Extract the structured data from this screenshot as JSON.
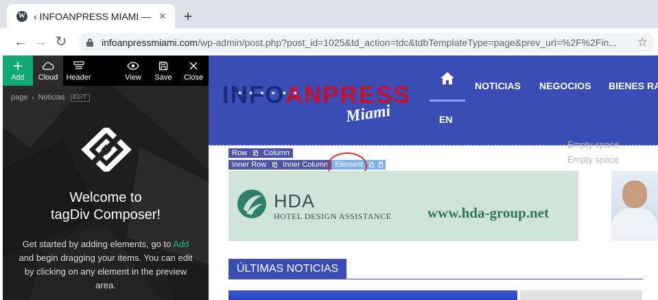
{
  "browser": {
    "tab_title": "‹ INFOANPRESS MIAMI —",
    "favicon": "W",
    "url_host": "infoanpressmiami.com",
    "url_path": "/wp-admin/post.php?post_id=1025&td_action=tdc&tdbTemplateType=page&prev_url=%2F%2Fin..."
  },
  "panel": {
    "toolbar": {
      "add": "Add",
      "cloud": "Cloud",
      "header": "Header",
      "view": "View",
      "save": "Save",
      "close": "Close"
    },
    "breadcrumb": {
      "page": "page",
      "current": "Noticias",
      "edit": "EDIT"
    },
    "welcome_line1": "Welcome to",
    "welcome_line2": "tagDiv Composer!",
    "intro_before": "Get started by adding elements, go to",
    "intro_add": "Add",
    "intro_after": "and begin dragging your items. You can edit by clicking on any element in the preview area."
  },
  "site": {
    "brand_info": "INFO",
    "brand_anpress": "ANPRESS",
    "brand_miami": "Miami",
    "nav": [
      "NOTICIAS",
      "NEGOCIOS",
      "BIENES RA"
    ],
    "lang": "EN",
    "empty_space_1": "Empty space",
    "empty_space_2": "Empty space",
    "tdc_row": "Row",
    "tdc_column": "Column",
    "tdc_inner_row": "Inner Row",
    "tdc_inner_column": "Inner Column",
    "tdc_element": "Element",
    "banner_hda": "HDA",
    "banner_sub": "HOTEL DESIGN ASSISTANCE",
    "banner_url": "www.hda-group.net",
    "section_title": "ÚLTIMAS NOTICIAS"
  },
  "colors": {
    "accent_green": "#12a875",
    "site_blue": "#3a4db4",
    "tdc_blue": "#4c55a8",
    "highlight_red": "#d92d2d"
  },
  "icons": [
    "plus-icon",
    "cloud-icon",
    "header-icon",
    "eye-icon",
    "save-icon",
    "close-icon",
    "home-icon",
    "lock-icon",
    "star-icon",
    "back-arrow-icon",
    "forward-arrow-icon",
    "reload-icon",
    "copy-icon",
    "trash-icon"
  ]
}
